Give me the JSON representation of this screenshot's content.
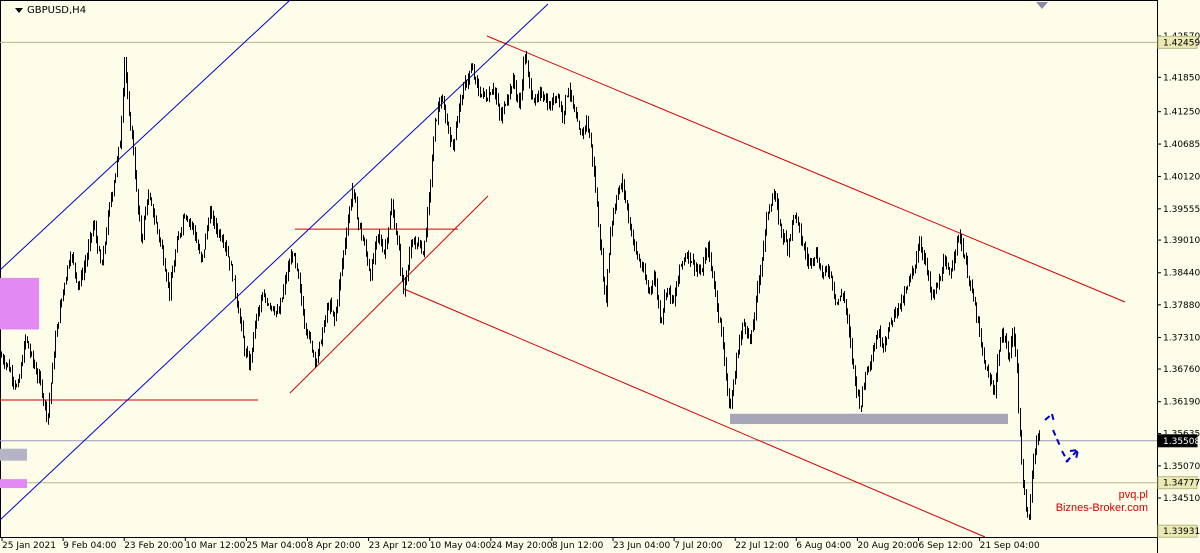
{
  "window": {
    "symbol_title": "GBPUSD,H4"
  },
  "watermark": {
    "line1": "pvq.pl",
    "line2": "Biznes-Broker.com"
  },
  "colors": {
    "background": "#fefde9",
    "candles": "#000000",
    "channel_red": "#d40000",
    "channel_blue": "#0000cc",
    "price_line": "#9a9ab4",
    "support_zone": "#a6a6b8",
    "magenta_box": "#e38af2",
    "gray_marker": "#b4b4c4",
    "label_box": "#ebe9b3",
    "forecast_arrow": "#0000cc"
  },
  "chart_data": {
    "type": "candlestick",
    "symbol": "GBPUSD",
    "timeframe": "H4",
    "y_ticks": [
      "1.42570",
      "1.41850",
      "1.41250",
      "1.40685",
      "1.40120",
      "1.39555",
      "1.39010",
      "1.38440",
      "1.37880",
      "1.37310",
      "1.36760",
      "1.36190",
      "1.35635",
      "1.35070",
      "1.34510"
    ],
    "ylim": [
      1.3393,
      1.4271
    ],
    "price_labels": [
      {
        "text": "1.42459",
        "value": 1.42459,
        "style": "box"
      },
      {
        "text": "1.35508",
        "value": 1.35508,
        "style": "current"
      },
      {
        "text": "1.34777",
        "value": 1.34777,
        "style": "box"
      },
      {
        "text": "1.33931",
        "value": 1.33931,
        "style": "box"
      }
    ],
    "x_ticks": [
      "25 Jan 2021",
      "9 Feb 04:00",
      "23 Feb 20:00",
      "10 Mar 12:00",
      "25 Mar 04:00",
      "8 Apr 20:00",
      "23 Apr 12:00",
      "10 May 04:00",
      "24 May 20:00",
      "8 Jun 12:00",
      "23 Jun 04:00",
      "7 Jul 20:00",
      "22 Jul 12:00",
      "6 Aug 04:00",
      "20 Aug 20:00",
      "6 Sep 12:00",
      "21 Sep 04:00"
    ],
    "price_path": [
      [
        0,
        1.37
      ],
      [
        8,
        1.368
      ],
      [
        17,
        1.364
      ],
      [
        25,
        1.373
      ],
      [
        32,
        1.369
      ],
      [
        40,
        1.365
      ],
      [
        47,
        1.359
      ],
      [
        55,
        1.373
      ],
      [
        62,
        1.381
      ],
      [
        70,
        1.388
      ],
      [
        78,
        1.382
      ],
      [
        86,
        1.387
      ],
      [
        93,
        1.393
      ],
      [
        101,
        1.385
      ],
      [
        109,
        1.396
      ],
      [
        115,
        1.402
      ],
      [
        120,
        1.408
      ],
      [
        124,
        1.422
      ],
      [
        128,
        1.412
      ],
      [
        132,
        1.408
      ],
      [
        137,
        1.396
      ],
      [
        141,
        1.39
      ],
      [
        147,
        1.398
      ],
      [
        154,
        1.394
      ],
      [
        162,
        1.388
      ],
      [
        169,
        1.381
      ],
      [
        176,
        1.389
      ],
      [
        184,
        1.395
      ],
      [
        193,
        1.392
      ],
      [
        201,
        1.386
      ],
      [
        209,
        1.395
      ],
      [
        216,
        1.392
      ],
      [
        224,
        1.39
      ],
      [
        232,
        1.384
      ],
      [
        238,
        1.378
      ],
      [
        244,
        1.371
      ],
      [
        249,
        1.368
      ],
      [
        255,
        1.376
      ],
      [
        262,
        1.38
      ],
      [
        270,
        1.379
      ],
      [
        278,
        1.377
      ],
      [
        286,
        1.384
      ],
      [
        292,
        1.388
      ],
      [
        298,
        1.383
      ],
      [
        304,
        1.376
      ],
      [
        310,
        1.372
      ],
      [
        316,
        1.369
      ],
      [
        322,
        1.374
      ],
      [
        328,
        1.379
      ],
      [
        334,
        1.376
      ],
      [
        340,
        1.384
      ],
      [
        346,
        1.392
      ],
      [
        352,
        1.399
      ],
      [
        358,
        1.393
      ],
      [
        364,
        1.389
      ],
      [
        370,
        1.384
      ],
      [
        377,
        1.391
      ],
      [
        384,
        1.388
      ],
      [
        391,
        1.396
      ],
      [
        397,
        1.39
      ],
      [
        403,
        1.381
      ],
      [
        409,
        1.388
      ],
      [
        416,
        1.39
      ],
      [
        423,
        1.388
      ],
      [
        429,
        1.398
      ],
      [
        434,
        1.41
      ],
      [
        440,
        1.415
      ],
      [
        446,
        1.411
      ],
      [
        452,
        1.406
      ],
      [
        458,
        1.413
      ],
      [
        464,
        1.417
      ],
      [
        471,
        1.42
      ],
      [
        478,
        1.416
      ],
      [
        486,
        1.415
      ],
      [
        493,
        1.417
      ],
      [
        500,
        1.411
      ],
      [
        506,
        1.415
      ],
      [
        513,
        1.418
      ],
      [
        519,
        1.413
      ],
      [
        524,
        1.423
      ],
      [
        529,
        1.417
      ],
      [
        535,
        1.414
      ],
      [
        542,
        1.416
      ],
      [
        549,
        1.413
      ],
      [
        556,
        1.416
      ],
      [
        562,
        1.412
      ],
      [
        568,
        1.417
      ],
      [
        574,
        1.412
      ],
      [
        580,
        1.408
      ],
      [
        586,
        1.411
      ],
      [
        591,
        1.406
      ],
      [
        595,
        1.399
      ],
      [
        600,
        1.389
      ],
      [
        605,
        1.379
      ],
      [
        610,
        1.392
      ],
      [
        616,
        1.398
      ],
      [
        622,
        1.4
      ],
      [
        628,
        1.394
      ],
      [
        635,
        1.388
      ],
      [
        642,
        1.385
      ],
      [
        648,
        1.381
      ],
      [
        654,
        1.384
      ],
      [
        660,
        1.376
      ],
      [
        666,
        1.382
      ],
      [
        673,
        1.379
      ],
      [
        679,
        1.385
      ],
      [
        686,
        1.388
      ],
      [
        693,
        1.386
      ],
      [
        700,
        1.384
      ],
      [
        707,
        1.389
      ],
      [
        714,
        1.382
      ],
      [
        720,
        1.375
      ],
      [
        725,
        1.368
      ],
      [
        729,
        1.36
      ],
      [
        733,
        1.365
      ],
      [
        738,
        1.372
      ],
      [
        744,
        1.376
      ],
      [
        750,
        1.372
      ],
      [
        756,
        1.38
      ],
      [
        762,
        1.388
      ],
      [
        768,
        1.396
      ],
      [
        774,
        1.398
      ],
      [
        780,
        1.392
      ],
      [
        787,
        1.389
      ],
      [
        794,
        1.395
      ],
      [
        801,
        1.39
      ],
      [
        808,
        1.386
      ],
      [
        815,
        1.388
      ],
      [
        822,
        1.384
      ],
      [
        829,
        1.385
      ],
      [
        836,
        1.379
      ],
      [
        843,
        1.381
      ],
      [
        849,
        1.373
      ],
      [
        855,
        1.365
      ],
      [
        860,
        1.361
      ],
      [
        865,
        1.367
      ],
      [
        871,
        1.37
      ],
      [
        877,
        1.374
      ],
      [
        883,
        1.372
      ],
      [
        889,
        1.375
      ],
      [
        895,
        1.378
      ],
      [
        901,
        1.379
      ],
      [
        907,
        1.382
      ],
      [
        913,
        1.385
      ],
      [
        919,
        1.39
      ],
      [
        925,
        1.386
      ],
      [
        931,
        1.38
      ],
      [
        937,
        1.382
      ],
      [
        943,
        1.386
      ],
      [
        949,
        1.384
      ],
      [
        955,
        1.389
      ],
      [
        959,
        1.391
      ],
      [
        964,
        1.387
      ],
      [
        970,
        1.382
      ],
      [
        976,
        1.377
      ],
      [
        982,
        1.37
      ],
      [
        988,
        1.366
      ],
      [
        994,
        1.364
      ],
      [
        999,
        1.372
      ],
      [
        1004,
        1.374
      ],
      [
        1008,
        1.369
      ],
      [
        1012,
        1.374
      ],
      [
        1016,
        1.37
      ],
      [
        1019,
        1.357
      ],
      [
        1022,
        1.349
      ],
      [
        1025,
        1.343
      ],
      [
        1028,
        1.341
      ],
      [
        1031,
        1.348
      ],
      [
        1034,
        1.354
      ],
      [
        1037,
        1.356
      ],
      [
        1040,
        1.355
      ]
    ],
    "annotations": [
      {
        "kind": "magenta-box",
        "note": "left demand zone"
      },
      {
        "kind": "support-zone",
        "value": 1.36
      },
      {
        "kind": "forecast-arrow",
        "direction": "down-then-up"
      }
    ]
  }
}
